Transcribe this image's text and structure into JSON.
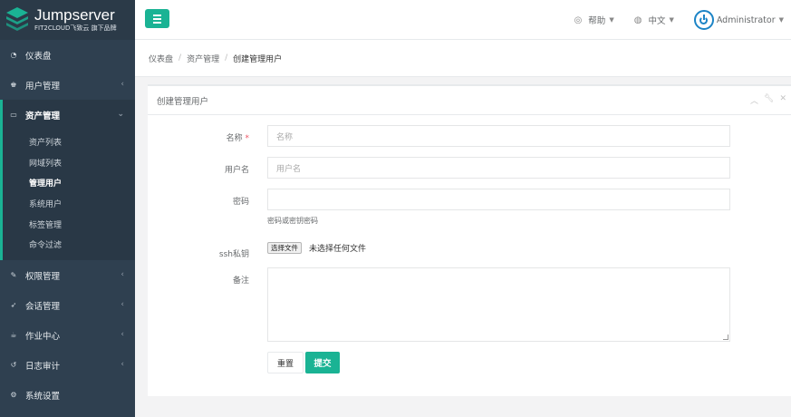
{
  "brand": {
    "title": "Jumpserver",
    "subtitle": "FIT2CLOUD飞致云 旗下品牌"
  },
  "sidebar": {
    "items": [
      {
        "label": "仪表盘",
        "icon": "dashboard-icon"
      },
      {
        "label": "用户管理",
        "icon": "users-icon"
      },
      {
        "label": "资产管理",
        "icon": "inbox-icon"
      },
      {
        "label": "权限管理",
        "icon": "edit-icon"
      },
      {
        "label": "会话管理",
        "icon": "rocket-icon"
      },
      {
        "label": "作业中心",
        "icon": "coffee-icon"
      },
      {
        "label": "日志审计",
        "icon": "history-icon"
      },
      {
        "label": "系统设置",
        "icon": "gears-icon"
      }
    ],
    "asset_submenu": [
      "资产列表",
      "网域列表",
      "管理用户",
      "系统用户",
      "标签管理",
      "命令过滤"
    ]
  },
  "topbar": {
    "help": "帮助",
    "language": "中文",
    "user": "Administrator"
  },
  "breadcrumb": [
    "仪表盘",
    "资产管理",
    "创建管理用户"
  ],
  "panel": {
    "title": "创建管理用户"
  },
  "form": {
    "name_label": "名称",
    "name_required": "*",
    "name_placeholder": "名称",
    "username_label": "用户名",
    "username_placeholder": "用户名",
    "password_label": "密码",
    "password_help": "密码或密钥密码",
    "sshkey_label": "ssh私钥",
    "file_button": "选择文件",
    "file_status": "未选择任何文件",
    "comment_label": "备注",
    "reset_button": "重置",
    "submit_button": "提交"
  },
  "colors": {
    "accent": "#1ab394",
    "sidebar_bg": "#2f4050",
    "avatar_ring": "#1c84c6"
  }
}
